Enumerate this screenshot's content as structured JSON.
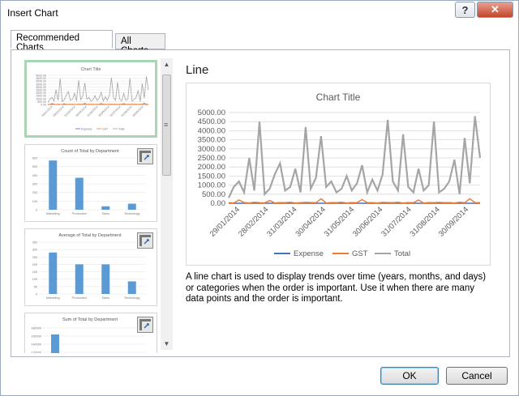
{
  "window": {
    "title": "Insert Chart",
    "help_label": "?",
    "close_label": "✕"
  },
  "tabs": [
    {
      "label": "Recommended Charts",
      "active": true
    },
    {
      "label": "All Charts",
      "active": false
    }
  ],
  "thumbnails": [
    {
      "title": "Chart Title",
      "kind": "line",
      "legend": [
        "Expense",
        "GST",
        "Total"
      ]
    },
    {
      "title": "Count of Total by Department",
      "kind": "bar",
      "ylim": [
        0,
        600
      ],
      "ticks": [
        "600",
        "500",
        "400",
        "300",
        "200",
        "100",
        "0"
      ],
      "categories": [
        "Marketing",
        "Production",
        "Sales",
        "Technology"
      ],
      "values": [
        570,
        370,
        40,
        70
      ]
    },
    {
      "title": "Average of Total by Department",
      "kind": "bar",
      "ylim": [
        0,
        350
      ],
      "ticks": [
        "350",
        "300",
        "250",
        "200",
        "150",
        "100",
        "50",
        "0"
      ],
      "categories": [
        "Marketing",
        "Production",
        "Sales",
        "Technology"
      ],
      "values": [
        280,
        200,
        200,
        85
      ]
    },
    {
      "title": "Sum of Total by Department",
      "kind": "bar",
      "ticks": [
        "180000",
        "160000",
        "140000",
        "120000"
      ]
    }
  ],
  "preview": {
    "heading": "Line",
    "description": "A line chart is used to display trends over time (years, months, and days) or categories when the order is important. Use it when there are many data points and the order is important."
  },
  "buttons": {
    "ok": "OK",
    "cancel": "Cancel"
  },
  "colors": {
    "expense": "#4472c4",
    "gst": "#ed7d31",
    "total": "#a5a5a5",
    "bar": "#5b9bd5",
    "selected_border": "#a7d6b2"
  },
  "chart_data": {
    "type": "line",
    "title": "Chart Title",
    "xlabel": "",
    "ylabel": "",
    "ylim": [
      0,
      5000
    ],
    "y_ticks": [
      "5000.00",
      "4500.00",
      "4000.00",
      "3500.00",
      "3000.00",
      "2500.00",
      "2000.00",
      "1500.00",
      "1000.00",
      "500.00",
      "0.00"
    ],
    "x_ticks": [
      "29/01/2014",
      "28/02/2014",
      "31/03/2014",
      "30/04/2014",
      "31/05/2014",
      "30/06/2014",
      "31/07/2014",
      "31/08/2014",
      "30/09/2014"
    ],
    "grid": true,
    "legend": "bottom",
    "series": [
      {
        "name": "Expense",
        "values": [
          0,
          0,
          0,
          0,
          0,
          0,
          0,
          0,
          0,
          0,
          0,
          0,
          0,
          0,
          0,
          0,
          0,
          0,
          0,
          0,
          0,
          0,
          0,
          0,
          0,
          0,
          0,
          0,
          0,
          0,
          0,
          0,
          0,
          0,
          0,
          0,
          0,
          0,
          0,
          0,
          0,
          0,
          0,
          0,
          0,
          0,
          0,
          0,
          0,
          0
        ]
      },
      {
        "name": "GST",
        "values": [
          30,
          20,
          180,
          40,
          20,
          60,
          30,
          20,
          150,
          20,
          40,
          30,
          60,
          20,
          30,
          50,
          40,
          30,
          250,
          20,
          40,
          30,
          60,
          20,
          40,
          30,
          200,
          40,
          30,
          20,
          50,
          40,
          30,
          60,
          20,
          40,
          30,
          180,
          20,
          40,
          30,
          50,
          30,
          40,
          20,
          60,
          30,
          250,
          40,
          30
        ]
      },
      {
        "name": "Total",
        "values": [
          300,
          900,
          1200,
          600,
          2500,
          700,
          4500,
          500,
          800,
          1600,
          2200,
          700,
          900,
          1900,
          600,
          4200,
          800,
          1400,
          3700,
          900,
          1200,
          600,
          800,
          1500,
          700,
          1100,
          2100,
          600,
          1300,
          700,
          1600,
          4600,
          1200,
          700,
          3800,
          900,
          600,
          1900,
          700,
          1000,
          4500,
          600,
          800,
          1200,
          2400,
          500,
          3600,
          1100,
          4800,
          2500
        ]
      }
    ]
  }
}
